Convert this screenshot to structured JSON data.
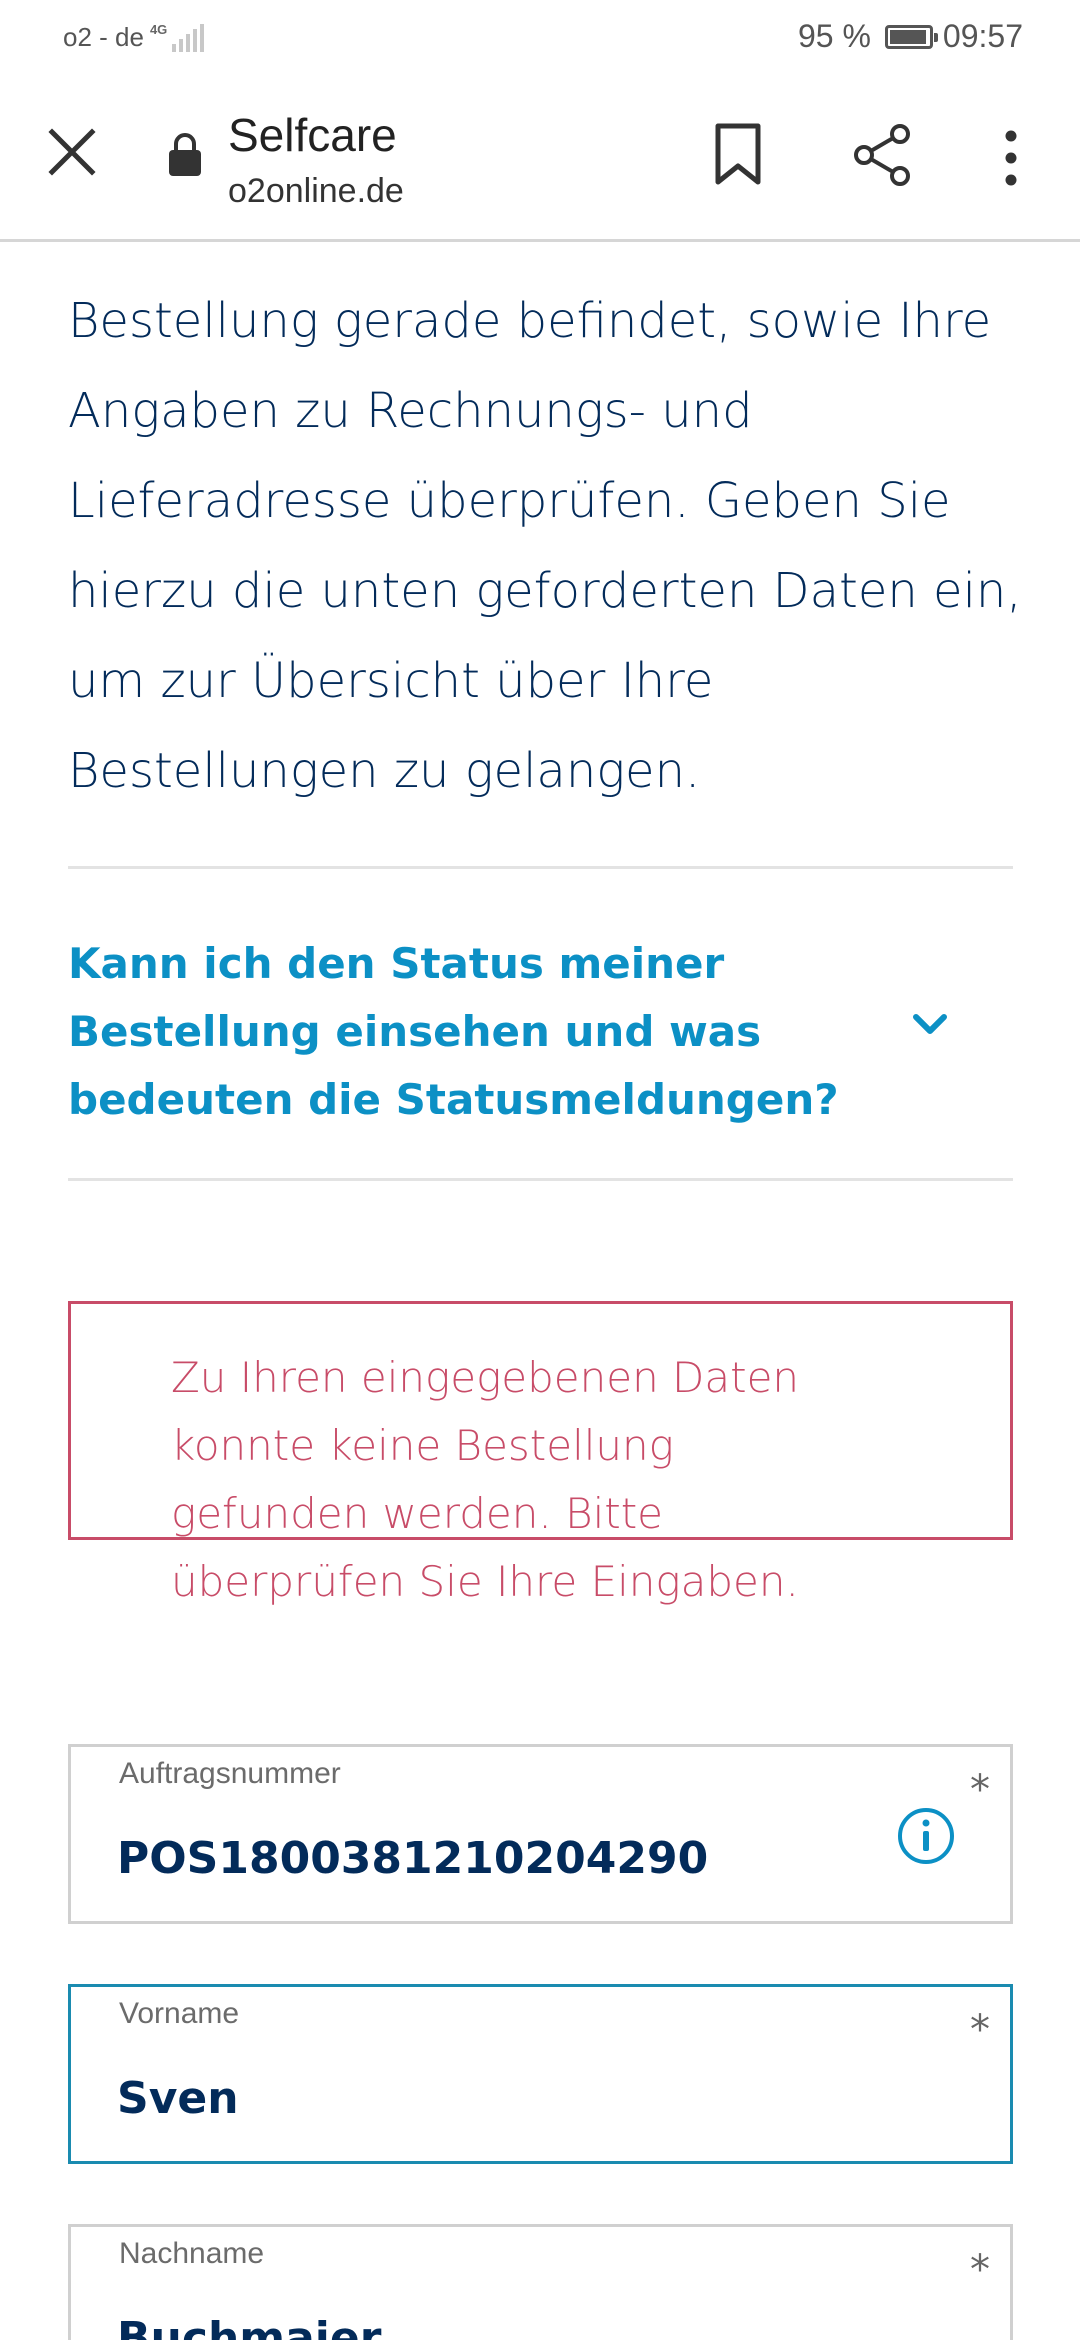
{
  "statusbar": {
    "carrier": "o2 - de",
    "network": "4G",
    "battery_percent_text": "95 %",
    "battery_level": 0.95,
    "time": "09:57"
  },
  "browser": {
    "title": "Selfcare",
    "url": "o2online.de",
    "icons": [
      "close-icon",
      "lock-icon",
      "bookmark-icon",
      "share-icon",
      "more-vert-icon"
    ]
  },
  "content": {
    "intro_text": "Bestellung gerade befindet, sowie Ihre Angaben zu Rechnungs- und Lieferadresse überprüfen. Geben Sie hierzu die unten geforderten Daten ein, um zur Übersicht über Ihre Bestellungen zu gelangen.",
    "faq_question": "Kann ich den Status meiner Bestellung einsehen und was bedeuten die Statusmeldungen?",
    "error_message": "Zu Ihren eingegebenen Daten konnte keine Bestellung gefunden werden. Bitte überprüfen Sie Ihre Eingaben."
  },
  "form": {
    "order_number": {
      "label": "Auftragsnummer",
      "value": "POS1800381210204290",
      "required_mark": "*"
    },
    "first_name": {
      "label": "Vorname",
      "value": "Sven",
      "required_mark": "*"
    },
    "last_name": {
      "label": "Nachname",
      "value": "Buchmaier",
      "required_mark": "*"
    }
  },
  "colors": {
    "text_primary": "#032b5a",
    "accent_link": "#0c90c5",
    "error": "#c84c68",
    "focus_border": "#1a8bb0"
  }
}
